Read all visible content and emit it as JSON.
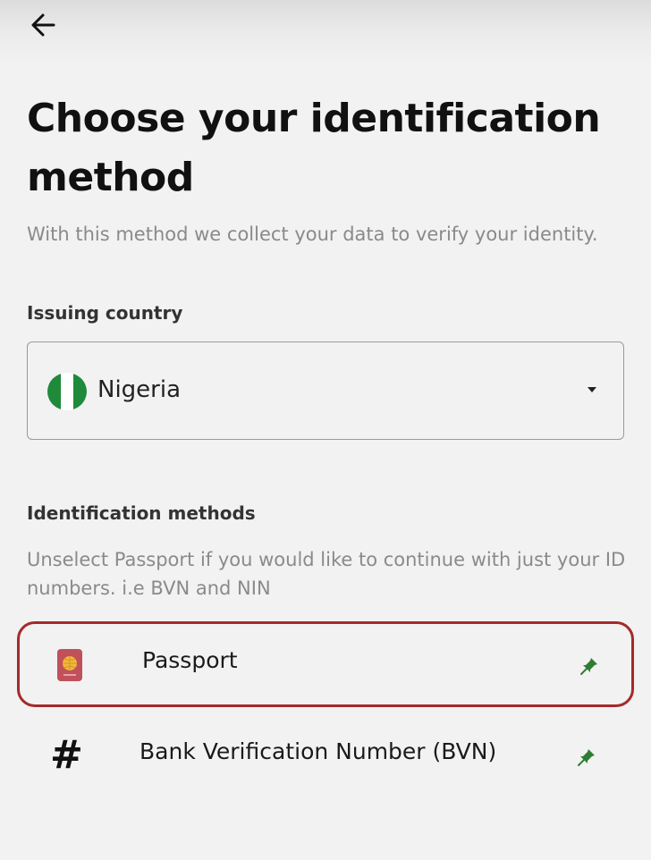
{
  "header": {
    "back_icon": "arrow-left-icon"
  },
  "title": "Choose your identification method",
  "subtitle": "With this method we collect your data to verify your identity.",
  "country": {
    "label": "Issuing country",
    "selected": "Nigeria",
    "flag_icon": "nigeria-flag-icon",
    "flag_colors": [
      "#1f8a3a",
      "#ffffff",
      "#1f8a3a"
    ]
  },
  "methods": {
    "label": "Identification methods",
    "hint": "Unselect Passport if you would like to continue with just your ID numbers. i.e BVN and NIN",
    "items": [
      {
        "label": "Passport",
        "icon": "passport-icon",
        "selected": true,
        "pin_icon": "pin-icon"
      },
      {
        "label": "Bank Verification Number (BVN)",
        "icon": "hash-icon",
        "icon_text": "#",
        "selected": false,
        "pin_icon": "pin-icon"
      }
    ]
  },
  "colors": {
    "selected_border": "#a52a2a",
    "pin": "#2e7d32",
    "passport": "#c0505a"
  }
}
